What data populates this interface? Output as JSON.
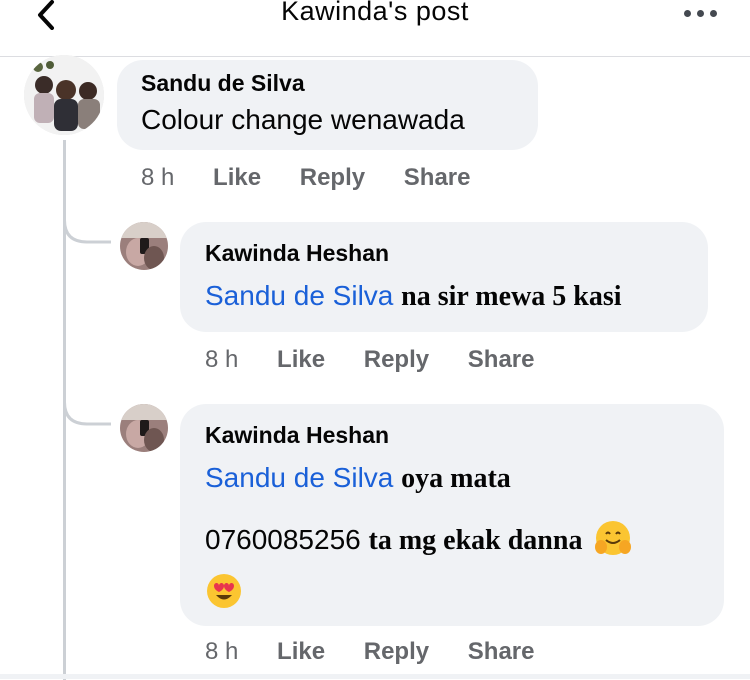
{
  "header": {
    "title": "Kawinda's post"
  },
  "comments": [
    {
      "author": "Sandu de Silva",
      "text": "Colour change wenawada",
      "time": "8 h",
      "like": "Like",
      "reply": "Reply",
      "share": "Share"
    }
  ],
  "replies": [
    {
      "author": "Kawinda Heshan",
      "mention": "Sandu de Silva",
      "text": "na sir mewa 5 kasi",
      "time": "8 h",
      "like": "Like",
      "reply": "Reply",
      "share": "Share"
    },
    {
      "author": "Kawinda Heshan",
      "mention": "Sandu de Silva",
      "text": "oya mata",
      "text2": "0760085256",
      "text3": "ta mg ekak danna",
      "emoji1": "hugging-face",
      "emoji2": "heart-eyes",
      "time": "8 h",
      "like": "Like",
      "reply": "Reply",
      "share": "Share"
    }
  ],
  "colors": {
    "mention": "#1a60d8",
    "bubble": "#f0f2f5",
    "meta": "#65676b"
  }
}
